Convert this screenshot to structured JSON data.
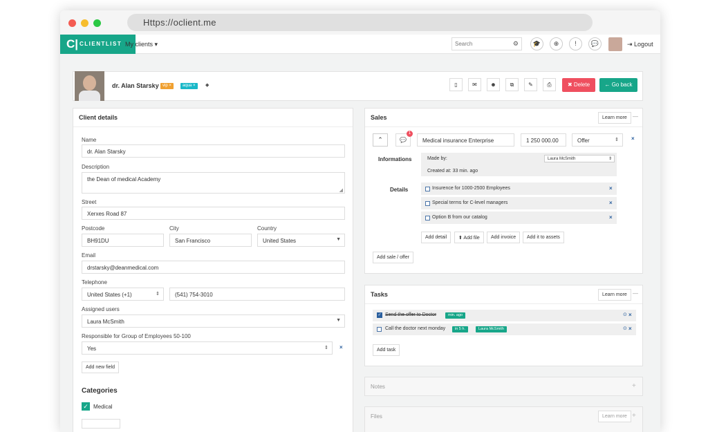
{
  "browser": {
    "url": "Https://oclient.me"
  },
  "nav": {
    "logo_letter": "C|",
    "logo_text": "CLIENTLIST",
    "my_clients": "My clients ▾",
    "search_placeholder": "Search",
    "logout": "Logout"
  },
  "header": {
    "client_name": "dr. Alan Starsky",
    "tags": [
      {
        "label": "vip ×",
        "color": "#f0a030"
      },
      {
        "label": "aqua ×",
        "color": "#1ab8c8"
      }
    ],
    "tag_icon": "◆",
    "delete_label": "✖ Delete",
    "goback_label": "← Go back"
  },
  "client_details": {
    "title": "Client details",
    "name_label": "Name",
    "name_value": "dr. Alan Starsky",
    "description_label": "Description",
    "description_value": "the Dean of medical Academy",
    "street_label": "Street",
    "street_value": "Xerxes Road 87",
    "postcode_label": "Postcode",
    "postcode_value": "BH91DU",
    "city_label": "City",
    "city_value": "San Francisco",
    "country_label": "Country",
    "country_value": "United States",
    "email_label": "Email",
    "email_value": "drstarsky@deanmedical.com",
    "telephone_label": "Telephone",
    "phone_country": "United States (+1)",
    "phone_number": "(541) 754-3010",
    "assigned_label": "Assigned users",
    "assigned_value": "Laura McSmith",
    "responsible_label": "Responsible for Group of Employees 50-100",
    "responsible_value": "Yes",
    "add_field": "Add new field",
    "categories_title": "Categories",
    "category_medical": "Medical"
  },
  "sales": {
    "title": "Sales",
    "learn_more": "Learn more",
    "collapse": "—",
    "badge": "1",
    "product": "Medical insurance Enterprise",
    "amount": "1 250 000.00",
    "stage": "Offer",
    "informations_label": "Informations",
    "made_by_label": "Made by:",
    "made_by_value": "Laura McSmith",
    "created_at": "Created at: 33 min. ago",
    "details_label": "Details",
    "details": [
      "Insurence for 1000-2500 Employees",
      "Special terms for C-level managers",
      "Option B from our catalog"
    ],
    "add_detail": "Add detail",
    "add_file": "⬆ Add file",
    "add_invoice": "Add invoice",
    "add_to_assets": "Add it to assets",
    "add_sale": "Add sale / offer"
  },
  "tasks": {
    "title": "Tasks",
    "learn_more": "Learn more",
    "collapse": "—",
    "items": [
      {
        "text": "Send the offer to Doctor",
        "badge": "min. ago",
        "done": true
      },
      {
        "text": "Call the doctor next monday",
        "badge": "in 5 h.",
        "assignee": "Laura McSmith",
        "done": false
      }
    ],
    "add_task": "Add task"
  },
  "notes": {
    "title": "Notes",
    "plus": "+"
  },
  "files": {
    "title": "Files",
    "learn_more": "Learn more",
    "plus": "+"
  },
  "colors": {
    "brand": "#17a689",
    "delete": "#ef4f5f",
    "link": "#2a5f9e"
  }
}
